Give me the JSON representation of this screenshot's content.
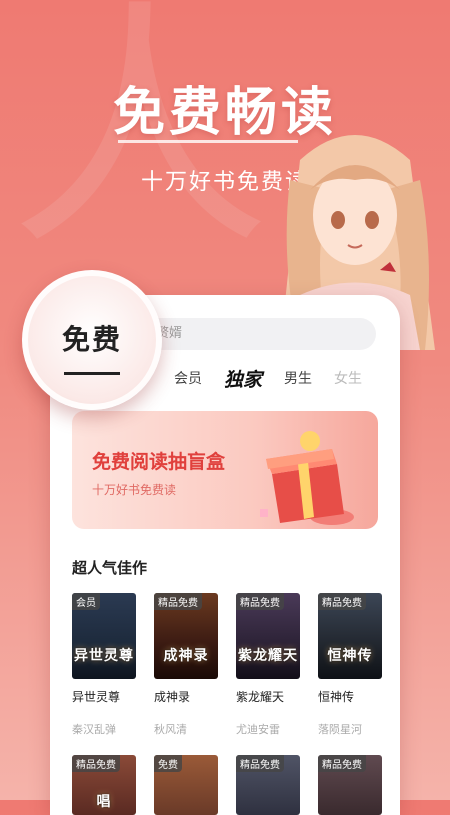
{
  "hero": {
    "title": "免费畅读",
    "subtitle": "十万好书免费读"
  },
  "badge": {
    "label": "免费"
  },
  "search": {
    "text": "赘婿"
  },
  "tabs": [
    {
      "label": "会员"
    },
    {
      "label": "独家"
    },
    {
      "label": "男生"
    },
    {
      "label": "女生"
    }
  ],
  "banner": {
    "title": "免费阅读抽盲盒",
    "subtitle": "十万好书免费读"
  },
  "section": {
    "title": "超人气佳作"
  },
  "books": [
    {
      "tag": "会员",
      "cover_title": "异世灵尊",
      "title": "异世灵尊",
      "author": "秦汉乱弹",
      "color": "#1d2a3c"
    },
    {
      "tag": "精品免费",
      "cover_title": "成神录",
      "title": "成神录",
      "author": "秋风清",
      "color": "#3a1a12"
    },
    {
      "tag": "精品免费",
      "cover_title": "紫龙耀天",
      "title": "紫龙耀天",
      "author": "尤迪安雷",
      "color": "#2c2236"
    },
    {
      "tag": "精品免费",
      "cover_title": "恒神传",
      "title": "恒神传",
      "author": "落陨星河",
      "color": "#22272f"
    }
  ],
  "books_row2": [
    {
      "tag": "精品免费",
      "cover_title": "唱",
      "color": "#5a2a22"
    },
    {
      "tag": "免费",
      "cover_title": "",
      "color": "#6a3a28"
    },
    {
      "tag": "精品免费",
      "cover_title": "",
      "color": "#2f3140"
    },
    {
      "tag": "精品免费",
      "cover_title": "",
      "color": "#3a2a2e"
    }
  ],
  "colors": {
    "accent": "#e0403c",
    "background": "#ef7a72"
  }
}
